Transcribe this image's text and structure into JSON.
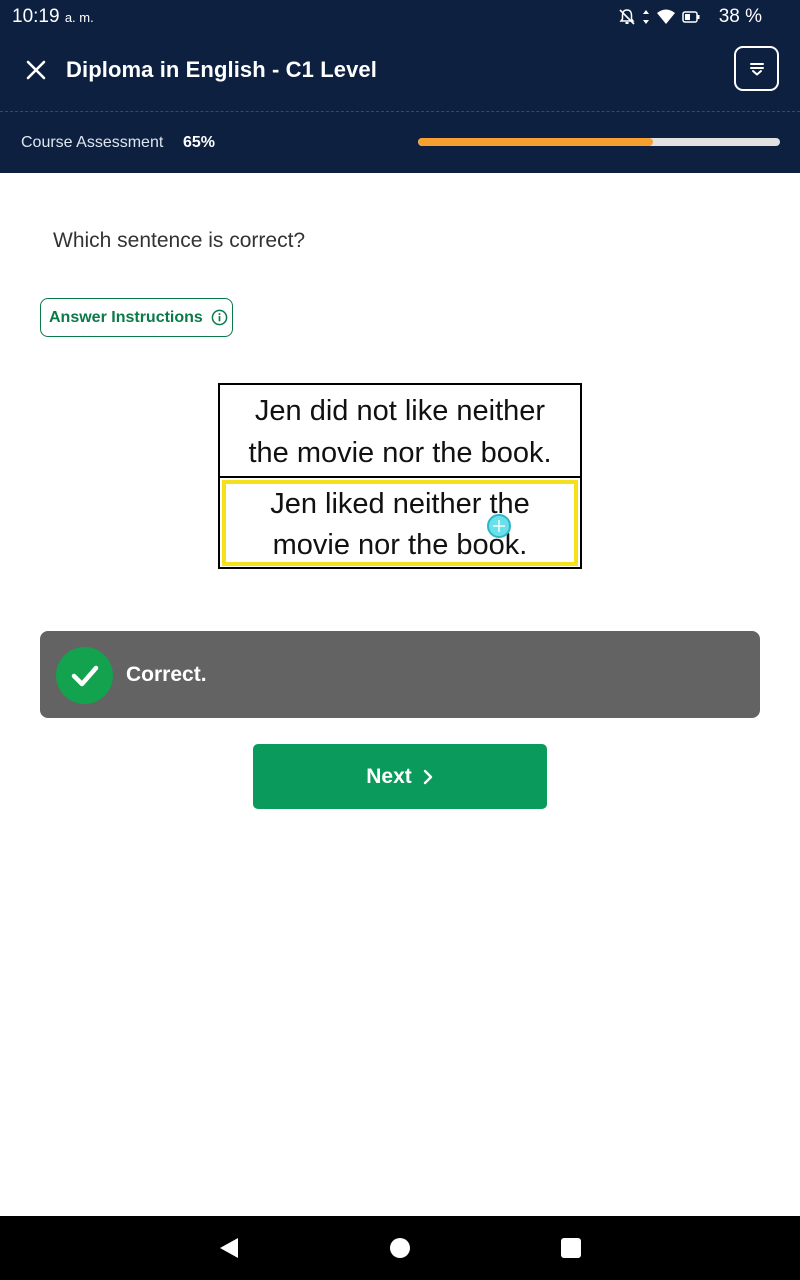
{
  "status_bar": {
    "time": "10:19",
    "ampm": "a. m.",
    "battery": "38 %",
    "icons": [
      "notifications-off-icon",
      "data-arrows-icon",
      "wifi-icon",
      "battery-icon"
    ]
  },
  "header": {
    "title": "Diploma in English - C1 Level",
    "close_icon": "close-icon",
    "menu_icon": "menu-icon"
  },
  "progress": {
    "label": "Course Assessment",
    "percent_text": "65%",
    "fraction": 0.65,
    "fill_color": "#f5a030"
  },
  "question": {
    "text": "Which sentence is correct?",
    "instructions_label": "Answer Instructions"
  },
  "options": [
    {
      "line1": "Jen did not like neither",
      "line2": "the movie nor the book."
    },
    {
      "line1": "Jen liked neither the",
      "line2": "movie nor the book.",
      "selected": true,
      "highlight_color": "#f4e01c"
    }
  ],
  "feedback": {
    "text": "Correct.",
    "status_color": "#13a24e"
  },
  "next_button": {
    "label": "Next",
    "color": "#0a9a5c"
  },
  "colors": {
    "header_bg": "#0d2040",
    "accent_green": "#0a7a48"
  }
}
